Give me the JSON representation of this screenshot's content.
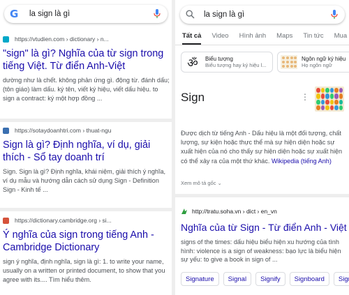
{
  "colors": {
    "link": "#1a0dab",
    "snippet": "#4d5156",
    "google_blue": "#4285f4"
  },
  "left": {
    "search": {
      "query": "la sign là gì",
      "logo": "G"
    },
    "results": [
      {
        "site": "https://vtudien.com › dictionary › n...",
        "favicon_color": "#00a8c8",
        "title": "\"sign\" là gì? Nghĩa của từ sign trong tiếng Việt. Từ điển Anh-Việt",
        "snippet": "dường như là chết. không phản ứng gì. động từ. đánh dấu; (tôn giáo) làm dấu. ký tên, viết ký hiệu, viết dấu hiệu. to sign a contract: ký một hợp đồng ..."
      },
      {
        "site": "https://sotaydoanhtri.com › thuat-ngu",
        "favicon_color": "#3a6fb0",
        "title": "Sign là gì? Định nghĩa, ví dụ, giải thích - Sổ tay doanh trí",
        "snippet": "Sign. Sign là gì? Định nghĩa, khái niệm, giải thích ý nghĩa, ví dụ mẫu và hướng dẫn cách sử dụng Sign - Definition Sign - Kinh tế ..."
      },
      {
        "site": "https://dictionary.cambridge.org › si...",
        "favicon_color": "#d5523b",
        "title": "Ý nghĩa của sign trong tiếng Anh - Cambridge Dictionary",
        "snippet": "sign ý nghĩa, định nghĩa, sign là gì: 1. to write your name, usually on a written or printed document, to show that you agree with its.... Tìm hiểu thêm."
      }
    ]
  },
  "right": {
    "search": {
      "query": "la sign là gì"
    },
    "tabs": [
      "Tất cả",
      "Video",
      "Hình ảnh",
      "Maps",
      "Tin tức",
      "Mua s"
    ],
    "active_tab": 0,
    "chips": [
      {
        "icon": "om-symbol-icon",
        "glyph": "ॐ",
        "title": "Biểu tượng",
        "subtitle": "Biểu tượng hay ký hiệu l..."
      },
      {
        "icon": "sign-language-icon",
        "glyph": "",
        "title": "Ngôn ngữ ký hiệu",
        "subtitle": "Họ ngôn ngữ"
      }
    ],
    "knowledge_panel": {
      "title": "Sign",
      "description": "Được dịch từ tiếng Anh - Dấu hiệu là một đối tượng, chất lượng, sự kiện hoặc thực thể mà sự hiện diện hoặc sự xuất hiện của nó cho thấy sự hiện diện hoặc sự xuất hiện có thể xảy ra của một thứ khác.",
      "source_link": "Wikipedia (tiếng Anh)",
      "more": "Xem mô tả gốc ⌄"
    },
    "result": {
      "site": "http://tratu.soha.vn › dict › en_vn",
      "title": "Nghĩa của từ Sign - Từ điển Anh - Việt",
      "snippet": "signs of the times: dấu hiệu biểu hiện xu hướng của tình hình: violence is a sign of weakness: bạo lực là biểu hiện sự yếu: to give a book in sign of ..."
    },
    "pills": [
      "Signature",
      "Signal",
      "Signify",
      "Signboard",
      "Signpost"
    ]
  }
}
